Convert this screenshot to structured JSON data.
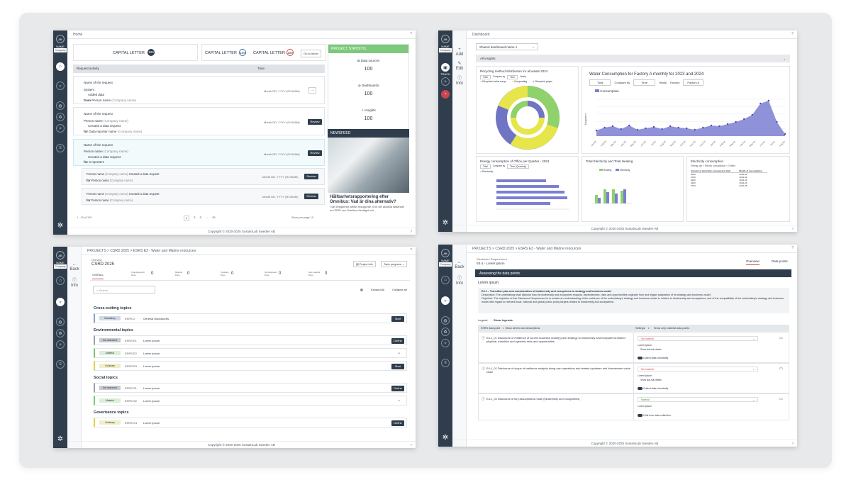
{
  "common": {
    "avatar": "AB",
    "name": "NAME",
    "company": "Company",
    "copyright": "Copyright © 2020-2025 SustainLab Sweden AB",
    "help": "?"
  },
  "screen1": {
    "breadcrumb": "Home",
    "capital": [
      {
        "label": "CAPITAL LETTER",
        "value": "100",
        "style": "dark"
      },
      {
        "label": "CAPITAL LETTER",
        "value": "100",
        "style": "outline-blue"
      },
      {
        "label": "CAPITAL LETTER",
        "value": "100",
        "style": "outline-red"
      }
    ],
    "go_inbox": "Go to Inbox",
    "table": {
      "col1": "Request activity",
      "col2": "Time"
    },
    "requests": [
      {
        "name": "Name of the request",
        "from": "System",
        "action": "Added data",
        "from_label": "from",
        "person": "Person name",
        "company": "(Company name)",
        "time": "Month DD, YYYY (00:00AM)"
      },
      {
        "name": "Name of the request",
        "person": "Person name",
        "company": "(Company name)",
        "action": "Created a data request",
        "for_label": "for",
        "for_value": "Data reporter name",
        "for_company": "(Company name)",
        "time": "Month DD, YYYY (00:00AM)",
        "button": "Review"
      },
      {
        "name": "Name of the request",
        "person": "Person name",
        "company": "(Company name)",
        "action": "Created a data request",
        "for_label": "for",
        "for_value": "3 reporters",
        "time": "Month DD, YYYY (00:00AM)",
        "button": "Review"
      }
    ],
    "subrequests": [
      {
        "person": "Person name",
        "company": "(Company name)",
        "action": "Created a data request",
        "for_label": "for",
        "for_value": "Person name",
        "for_company": "(Company name)",
        "time": "Month DD, YYYY (00:00AM)",
        "button": "Review"
      },
      {
        "person": "Person name",
        "company": "(Company name)",
        "action": "Created a data request",
        "for_label": "for",
        "for_value": "Person name",
        "for_company": "(Company name)",
        "time": "Month DD, YYYY (00:00AM)",
        "button": "Review"
      }
    ],
    "pagination": {
      "range": "1 - 10 of 100",
      "pages": [
        "1",
        "2",
        "3",
        "...",
        "10"
      ],
      "per_page_label": "Show per page",
      "per_page": "10"
    },
    "stats": {
      "header": "PROJECT STATISTIC",
      "items": [
        {
          "label": "Data sources",
          "value": "100"
        },
        {
          "label": "Dashboards",
          "value": "100"
        },
        {
          "label": "Insights",
          "value": "100"
        }
      ]
    },
    "news": {
      "header": "NEWSFEED",
      "title": "Hållbarhetsrapportering efter Omnibus: Vad är dina alternativ?",
      "body": "I vår föregående artikel redogjorde vi för det aktuella tillståndet av CSRD och Omnibus-förslaget och..."
    }
  },
  "screen2": {
    "breadcrumb": "Dashboard",
    "side": [
      {
        "label": "Add"
      },
      {
        "label": "Edit"
      },
      {
        "label": "Info"
      }
    ],
    "track": "TRACK",
    "select": "Shared dashboard name 1",
    "insights": "All insights",
    "recycling": {
      "title": "Recycling method distribution for all waste 2024",
      "tabs": [
        "Total",
        "Compare by",
        "Time",
        "Yearly"
      ],
      "legend": [
        "Recycled metal scrap",
        "Composting",
        "Recycled paper"
      ],
      "colors": [
        "#8fd16a",
        "#e6e64a",
        "#6f75c2"
      ]
    },
    "water": {
      "title": "Water Consumption for Factory A monthly for 2023 and 2024",
      "total": "Total",
      "compare_by": "Compare by",
      "time": "Time",
      "yearly": "Yearly",
      "factory_label": "Factory",
      "factory": "Factory A",
      "legend": "Consumption",
      "ylabel": "Megaliters",
      "color": "#7b7fd1"
    },
    "energy": {
      "title": "Energy consumption of Office per Quarter - 2024",
      "tabs": [
        "Total",
        "Compare by",
        "Time (Quarterly)"
      ],
      "legend": "Electricity",
      "color": "#7b7fd1"
    },
    "heating": {
      "title": "Total Electricity and Total Heating",
      "legend": [
        "Heating",
        "Electricity"
      ],
      "colors": [
        "#8fd16a",
        "#7b7fd1"
      ]
    },
    "elec": {
      "title": "Electricity consumption",
      "filter": "Energy use > Electric consumption > 3 filters",
      "cols": [
        "Amount of electricity consumed in kwh",
        "Month of consumption"
      ],
      "rows": [
        [
          "3500",
          "2024-01"
        ],
        [
          "4700",
          "2024-02"
        ],
        [
          "4000",
          "2024-03"
        ],
        [
          "4200",
          "2024-04"
        ],
        [
          "3700",
          "2024-05"
        ]
      ]
    }
  },
  "screen3": {
    "crumbs": "PROJECTS  >  CSRD 2025  >  ESRS E3 - Water and Marine resources",
    "back": "Back",
    "info": "Info",
    "overview": "Overview",
    "title": "CSRD 2025",
    "project_info": "Project info",
    "topic_progress": "Topic progress",
    "tabs": [
      {
        "label": "OVERALL",
        "value": ""
      },
      {
        "label": "Total data point\nDone",
        "value": "0"
      },
      {
        "label": "Material\nDone",
        "value": "0"
      },
      {
        "label": "Voluntary\nDone",
        "value": "0"
      },
      {
        "label": "Not Assessed\nDone",
        "value": "0"
      },
      {
        "label": "Non-material\nDone",
        "value": "0"
      }
    ],
    "search": "Search",
    "expand": "Expand All",
    "collapse": "Collapse all",
    "groups": [
      {
        "title": "Cross-cutting topics",
        "rows": [
          {
            "tag": "Mandatory",
            "code": "ESRS 2",
            "name": "General Disclosures",
            "action": "Start"
          }
        ]
      },
      {
        "title": "Environmental topics",
        "rows": [
          {
            "tag": "Not assessed",
            "code": "ESRS E1",
            "name": "Lorem ipsum",
            "action": "Define"
          },
          {
            "tag": "Material",
            "code": "ESRS E2",
            "name": "Lorem ipsum",
            "action": "v"
          },
          {
            "tag": "Voluntary",
            "code": "ESRS E3",
            "name": "Lorem ipsum",
            "action": "Start"
          }
        ]
      },
      {
        "title": "Social topics",
        "rows": [
          {
            "tag": "Not assessed",
            "code": "ESRS S1",
            "name": "Lorem ipsum",
            "action": "Define"
          },
          {
            "tag": "Material",
            "code": "ESRS S2",
            "name": "Lorem ipsum",
            "action": "v"
          }
        ]
      },
      {
        "title": "Governance topics",
        "rows": [
          {
            "tag": "Voluntary",
            "code": "ESRS G1",
            "name": "Lorem ipsum",
            "action": "Define"
          }
        ]
      }
    ]
  },
  "screen4": {
    "crumbs": "PROJECTS  >  CSRD 2025  >  ESRS E3 - Water and Marine resources",
    "back": "Back",
    "info": "Info",
    "dr_label": "Disclosure Requirement",
    "dr_title": "E4-1 - Lorem ipsum",
    "tab_overview": "Overview",
    "tab_points": "Data points",
    "bar": "Assessing the data points",
    "lorem": "Lorem ipsum",
    "desc_title": "E4-1 – Transition plan and consideration of biodiversity and ecosystems in strategy and business model",
    "desc": "Description: The undertaking shall disclose how its biodiversity and ecosystem impacts, dependencies, risks and opportunities originate from and trigger adaptation of its strategy and business model.",
    "objective": "Objective: The objective of this Disclosure Requirement is to enable an understanding of the resilience of the undertaking's strategy and business model in relation to biodiversity and ecosystems, and of the compatibility of the undertaking's strategy and business model with regard to relevant local, national and global public policy targets related to biodiversity and ecosystems.",
    "legend": "Legend:",
    "show_legends": "Show legends",
    "col1": "ESRS data point",
    "show_all": "Show all info and descriptions",
    "settings": "Settings:",
    "only_material": "Show only material data points",
    "points": [
      {
        "text": "E4-1_01 Disclosure of resilience of current business model(s) and strategy to biodiversity and ecosystems-related physical, transition and systemic risks and opportunities",
        "status": "Not material",
        "sub": "Lorem ipsum",
        "subsub": "Show sub-sub deeds",
        "toggle": "Collect data voluntarily"
      },
      {
        "text": "E4-1_02 Disclosure of scope of resilience analysis along own operations and related upstream and downstream value chain",
        "status": "Not material",
        "sub": "Lorem ipsum",
        "subsub": "Show sub-sub deeds",
        "toggle": "Collect data voluntarily"
      },
      {
        "text": "E4-1_03 Disclosure of key assumptions made (biodiversity and ecosystems)",
        "status": "Material",
        "sub": "Lorem ipsum",
        "subsub": "",
        "toggle": "Omit from data collection"
      }
    ]
  }
}
